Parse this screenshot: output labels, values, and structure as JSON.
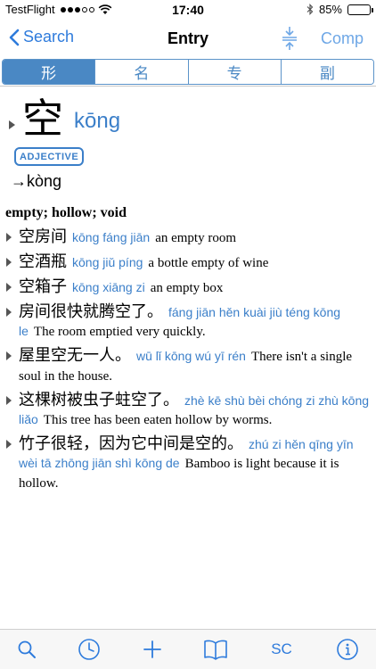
{
  "status_bar": {
    "carrier": "TestFlight",
    "time": "17:40",
    "battery": "85%",
    "battery_level": 0.85
  },
  "nav": {
    "back_label": "Search",
    "title": "Entry",
    "right_label": "Comp"
  },
  "tabs": [
    {
      "label": "形",
      "active": true
    },
    {
      "label": "名",
      "active": false
    },
    {
      "label": "专",
      "active": false
    },
    {
      "label": "副",
      "active": false
    }
  ],
  "entry": {
    "character": "空",
    "pinyin": "kōng",
    "part_of_speech": "ADJECTIVE",
    "variant": "→kòng",
    "definition": "empty; hollow; void",
    "examples": [
      {
        "zh": "空房间",
        "pinyin": "kōng fáng jiān",
        "en": "an empty room"
      },
      {
        "zh": "空酒瓶",
        "pinyin": "kōng jiǔ píng",
        "en": "a bottle empty of wine"
      },
      {
        "zh": "空箱子",
        "pinyin": "kōng xiāng zi",
        "en": "an empty box"
      },
      {
        "zh": "房间很快就腾空了。",
        "pinyin": "fáng jiān hěn kuài jiù téng kōng le",
        "en": "The room emptied very quickly."
      },
      {
        "zh": "屋里空无一人。",
        "pinyin": "wū lǐ kōng wú yī rén",
        "en": "There isn't a single soul in the house."
      },
      {
        "zh": "这棵树被虫子蛀空了。",
        "pinyin": "zhè kē shù bèi chóng zi zhù kōng liǎo",
        "en": "This tree has been eaten hollow by worms."
      },
      {
        "zh": "竹子很轻，因为它中间是空的。",
        "pinyin": "zhú zi hěn qīng yīn wèi tā zhōng jiān shì kōng de",
        "en": "Bamboo is light because it is hollow."
      }
    ]
  },
  "toolbar": {
    "items": [
      {
        "icon": "search-icon"
      },
      {
        "icon": "history-clock-icon"
      },
      {
        "icon": "add-plus-icon"
      },
      {
        "icon": "book-icon"
      },
      {
        "label": "SC"
      },
      {
        "icon": "info-icon"
      }
    ],
    "sc_label": "SC"
  },
  "colors": {
    "accent": "#2e7bdc",
    "pinyin": "#3b7fc9",
    "segment": "#4a88c4"
  }
}
